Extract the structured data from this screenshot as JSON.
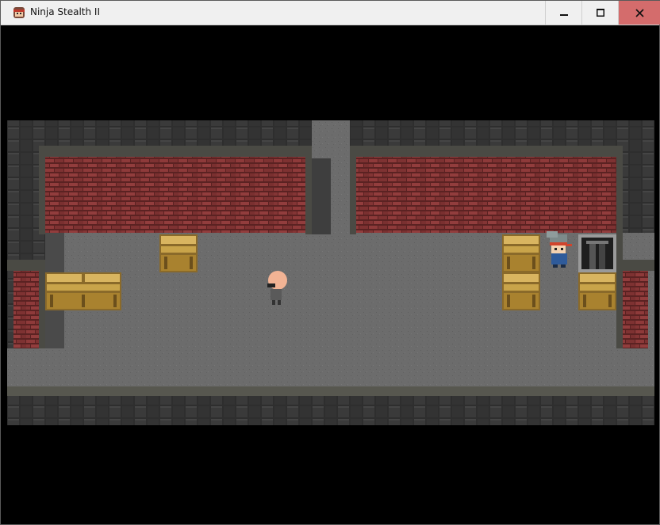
{
  "window": {
    "title": "Ninja Stealth II",
    "icons": {
      "app": "ninja-head-icon",
      "minimize": "minimize-icon",
      "maximize": "maximize-icon",
      "close": "close-icon"
    },
    "colors": {
      "titlebar": "#f0f0f0",
      "close_button": "#d46c6c"
    }
  },
  "game": {
    "scene": "dungeon-room",
    "colors": {
      "floor": "#6c6c6c",
      "brick_wall": "#8e3a3a",
      "stone_wall": "#2c2c2c",
      "crate": "#c9a44a"
    },
    "sprites": [
      "player-ninja",
      "guard-bald",
      "exit-door"
    ]
  }
}
